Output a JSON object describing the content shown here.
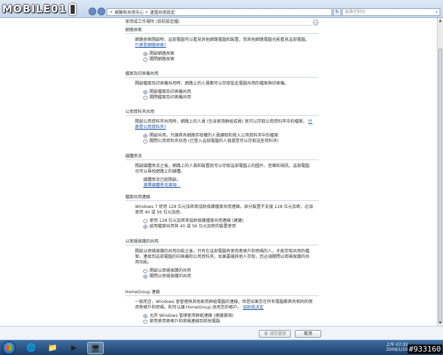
{
  "logo": {
    "text": "MOBILE01"
  },
  "address": {
    "crumbs": [
      "«",
      "網路和共用中心",
      "▸",
      "進階共用設定"
    ],
    "search_placeholder": "搜尋控制台"
  },
  "profile_label": "家用或工作場所 (目前設定檔)",
  "sections": {
    "discovery": {
      "title": "網路探索",
      "desc": "網路探索開啟時，這部電腦可以看見其他網路電腦和裝置，而其他網路電腦也能看見這部電腦。",
      "link": "什麼是網路探索?",
      "options": [
        "開啟網路探索",
        "關閉網路探索"
      ]
    },
    "file_printer": {
      "title": "檔案及印表機共用",
      "desc": "開啟檔案及印表機共用時，網路上的人員都可以存取從此電腦共用的檔案與印表機。",
      "options": [
        "開啟檔案及印表機共用",
        "關閉檔案及印表機共用"
      ]
    },
    "public_folder": {
      "title": "公用資料夾共用",
      "desc": "開啟公用資料夾共用時，網路上的人員 (包含家用群組成員) 就可以存取公用資料夾中的檔案。",
      "link": "什麼是公用資料夾?",
      "options": [
        "開啟共用，只讓具有網路存取權的人員讀取和寫入公用資料夾中的檔案",
        "關閉公用資料夾共用 (已登入這部電腦的人員還是可以存取這些資料夾)"
      ]
    },
    "media": {
      "title": "媒體串流",
      "desc": "開啟媒體串流之後，網路上的人員和裝置就可以存取這部電腦上的圖片、音樂和視訊。這部電腦也可以尋找網路上的媒體。",
      "status": "媒體串流已經開啟。",
      "link": "選擇媒體串流選項..."
    },
    "connections": {
      "title": "檔案共用連線",
      "desc": "Windows 7 使用 128 位元加密來協助保護檔案共用連線。部分裝置不支援 128 位元加密，必須使用 40 或 56 位元加密。",
      "options": [
        "使用 128 位元加密來協助保護檔案共用連線 (建議)",
        "啟用檔案共用供 40 或 56 位元加密的裝置使用"
      ]
    },
    "password": {
      "title": "以密碼保護的共用",
      "desc": "開啟以密碼保護的共用功能之後，只有在這部電腦有使用者帳戶和密碼的人，才能存取共用的檔案、連接到這部電腦的印表機和公用資料夾。如果要讓其他人存取，您必須關閉以密碼保護的共用功能。",
      "options": [
        "開啟以密碼保護的共用",
        "關閉以密碼保護的共用"
      ]
    },
    "homegroup": {
      "title": "HomeGroup 連線",
      "desc": "一般而言，Windows 會管理與其他家用群組電腦的連線，但是如果您在所有電腦都具有相同的使用者帳戶和密碼，則可以讓 HomeGroup 改用您的帳戶。",
      "link": "協助我決定",
      "options": [
        "允許 Windows 管理家用群組連線 (建議選項)",
        "使用使用者帳戶和密碼連線到其他電腦"
      ]
    }
  },
  "buttons": {
    "save": "儲存變更",
    "cancel": "取消"
  },
  "taskbar": {
    "clock_line1": "上午 07:33",
    "clock_line2": "2009/1/10"
  },
  "watermark": "#933160",
  "colors": {
    "link": "#1b53a6",
    "radio_selected": "#1d5fb5",
    "taskbar": "#1b3f6b"
  }
}
